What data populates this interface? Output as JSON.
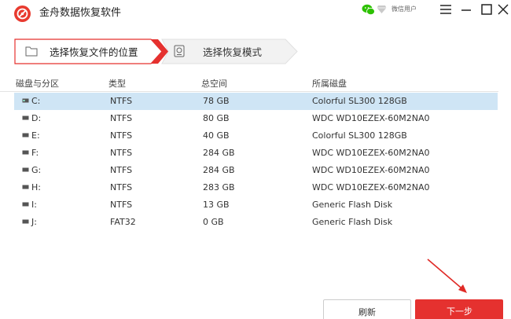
{
  "app": {
    "title": "金舟数据恢复软件",
    "wechat_user": "微信用户",
    "icons": [
      "app-logo-icon",
      "wechat-icon",
      "diamond-icon",
      "menu-icon",
      "minimize-icon",
      "maximize-icon",
      "close-icon"
    ],
    "accent": "#e5312f"
  },
  "steps": [
    {
      "label": "选择恢复文件的位置",
      "icon": "folder-icon",
      "active": true
    },
    {
      "label": "选择恢复模式",
      "icon": "disk-icon",
      "active": false
    }
  ],
  "table": {
    "headers": [
      "磁盘与分区",
      "类型",
      "总空间",
      "所属磁盘"
    ],
    "rows": [
      {
        "partition": "C:",
        "type": "NTFS",
        "space": "78 GB",
        "disk": "Colorful SL300 128GB",
        "selected": true
      },
      {
        "partition": "D:",
        "type": "NTFS",
        "space": "80 GB",
        "disk": "WDC WD10EZEX-60M2NA0",
        "selected": false
      },
      {
        "partition": "E:",
        "type": "NTFS",
        "space": "40 GB",
        "disk": "Colorful SL300 128GB",
        "selected": false
      },
      {
        "partition": "F:",
        "type": "NTFS",
        "space": "284 GB",
        "disk": "WDC WD10EZEX-60M2NA0",
        "selected": false
      },
      {
        "partition": "G:",
        "type": "NTFS",
        "space": "284 GB",
        "disk": "WDC WD10EZEX-60M2NA0",
        "selected": false
      },
      {
        "partition": "H:",
        "type": "NTFS",
        "space": "283 GB",
        "disk": "WDC WD10EZEX-60M2NA0",
        "selected": false
      },
      {
        "partition": "I:",
        "type": "NTFS",
        "space": "13 GB",
        "disk": "Generic Flash Disk",
        "selected": false
      },
      {
        "partition": "J:",
        "type": "FAT32",
        "space": "0 GB",
        "disk": "Generic Flash Disk",
        "selected": false
      }
    ]
  },
  "buttons": {
    "refresh": "刷新",
    "next": "下一步"
  }
}
